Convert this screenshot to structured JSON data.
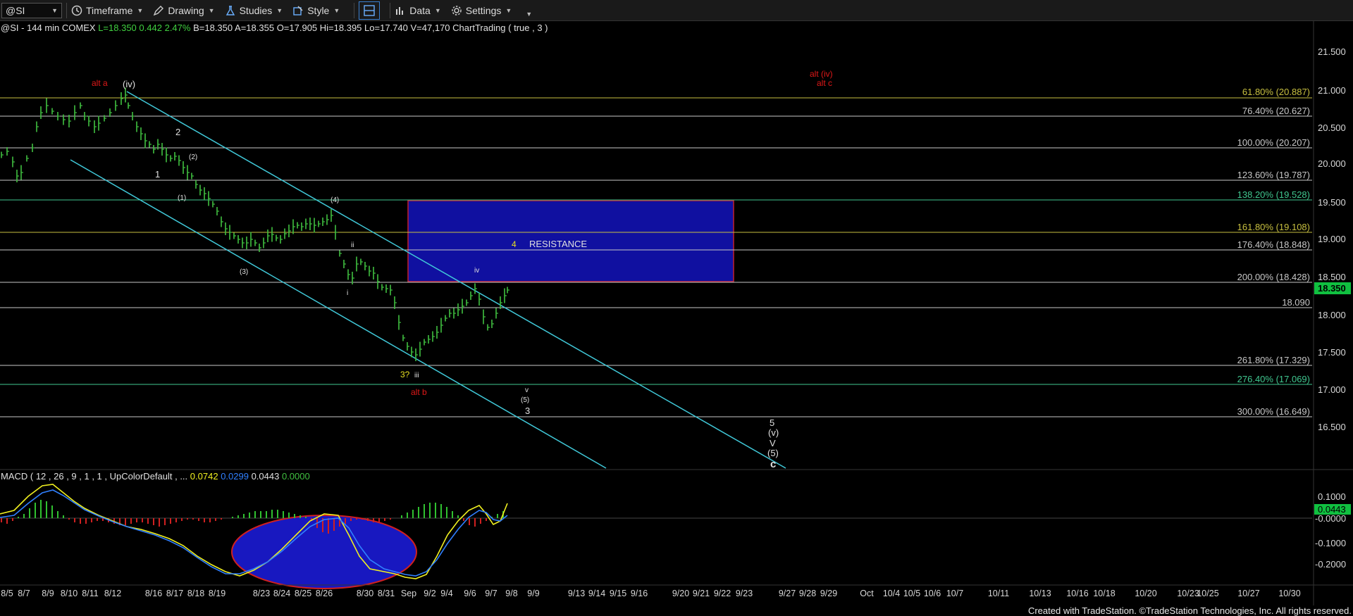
{
  "toolbar": {
    "symbol": "@SI",
    "timeframe": "Timeframe",
    "drawing": "Drawing",
    "studies": "Studies",
    "style": "Style",
    "data": "Data",
    "settings": "Settings"
  },
  "header": {
    "symbol_info": "@SI - 144 min  COMEX",
    "last": "L=18.350",
    "change": "0.442",
    "pct": "2.47%",
    "bid": "B=18.350",
    "ask": "A=18.355",
    "open": "O=17.905",
    "high": "Hi=18.395",
    "low": "Lo=17.740",
    "volume": "V=47,170",
    "study": "ChartTrading ( true , 3 )"
  },
  "price_axis": {
    "ticks": [
      "21.500",
      "21.000",
      "20.500",
      "20.000",
      "19.500",
      "19.000",
      "18.500",
      "18.000",
      "17.500",
      "17.000",
      "16.500"
    ],
    "last_price_badge": "18.350"
  },
  "fib_levels": [
    {
      "label": "61.80% (20.887)",
      "color": "#c8c040"
    },
    {
      "label": "76.40% (20.627)",
      "color": "#c8c8c8"
    },
    {
      "label": "100.00% (20.207)",
      "color": "#c8c8c8"
    },
    {
      "label": "123.60% (19.787)",
      "color": "#c8c8c8"
    },
    {
      "label": "138.20% (19.528)",
      "color": "#40c890"
    },
    {
      "label": "161.80% (19.108)",
      "color": "#c8c040"
    },
    {
      "label": "176.40% (18.848)",
      "color": "#c8c8c8"
    },
    {
      "label": "200.00% (18.428)",
      "color": "#c8c8c8"
    },
    {
      "label": "18.090",
      "color": "#c8c8c8"
    },
    {
      "label": "261.80% (17.329)",
      "color": "#c8c8c8"
    },
    {
      "label": "276.40% (17.069)",
      "color": "#40c890"
    },
    {
      "label": "300.00% (16.649)",
      "color": "#c8c8c8"
    }
  ],
  "resistance_box": {
    "label": "RESISTANCE",
    "wave": "4",
    "color": "#1010a0"
  },
  "wave_labels": {
    "alt_a": "alt a",
    "iv_paren": "(iv)",
    "two": "2",
    "two_paren": "(2)",
    "one": "1",
    "one_paren": "(1)",
    "four_paren": "(4)",
    "three_paren": "(3)",
    "small_ii": "ii",
    "small_i": "i",
    "small_iv": "iv",
    "three_q": "3?",
    "small_iii": "iii",
    "alt_b": "alt b",
    "small_v": "v",
    "five_paren": "(5)",
    "three": "3",
    "alt_iv": "alt (iv)",
    "alt_c": "alt c",
    "target_5": "5",
    "target_v_paren": "(v)",
    "target_V": "V",
    "target_5_paren": "(5)",
    "target_c": "c"
  },
  "macd": {
    "title": "MACD ( 12 , 26 , 9 , 1 , 1 , UpColorDefault , ...",
    "v1": "0.0742",
    "v2": "0.0299",
    "v3": "0.0443",
    "v4": "0.0000",
    "ticks": [
      "0.1000",
      "-0.0000",
      "-0.1000",
      "-0.2000"
    ],
    "badge": "0.0443"
  },
  "date_axis": [
    "8/5",
    "8/7",
    "8/9",
    "8/10",
    "8/11",
    "8/12",
    "8/16",
    "8/17",
    "8/18",
    "8/19",
    "8/23",
    "8/24",
    "8/25",
    "8/26",
    "8/30",
    "8/31",
    "Sep",
    "9/2",
    "9/4",
    "9/6",
    "9/7",
    "9/8",
    "9/9",
    "9/13",
    "9/14",
    "9/15",
    "9/16",
    "9/20",
    "9/21",
    "9/22",
    "9/23",
    "9/27",
    "9/28",
    "9/29",
    "Oct",
    "10/4",
    "10/5",
    "10/6",
    "10/7",
    "10/11",
    "10/13",
    "10/16",
    "10/18",
    "10/20",
    "10/23",
    "10/25",
    "10/27",
    "10/30"
  ],
  "footer": "Created with TradeStation. ©TradeStation Technologies, Inc. All rights reserved.",
  "colors": {
    "bars": "#40c040",
    "channel": "#40c8d8",
    "macd_line": "#f0f020",
    "signal_line": "#3080ff",
    "ellipse": "#1818c0"
  }
}
